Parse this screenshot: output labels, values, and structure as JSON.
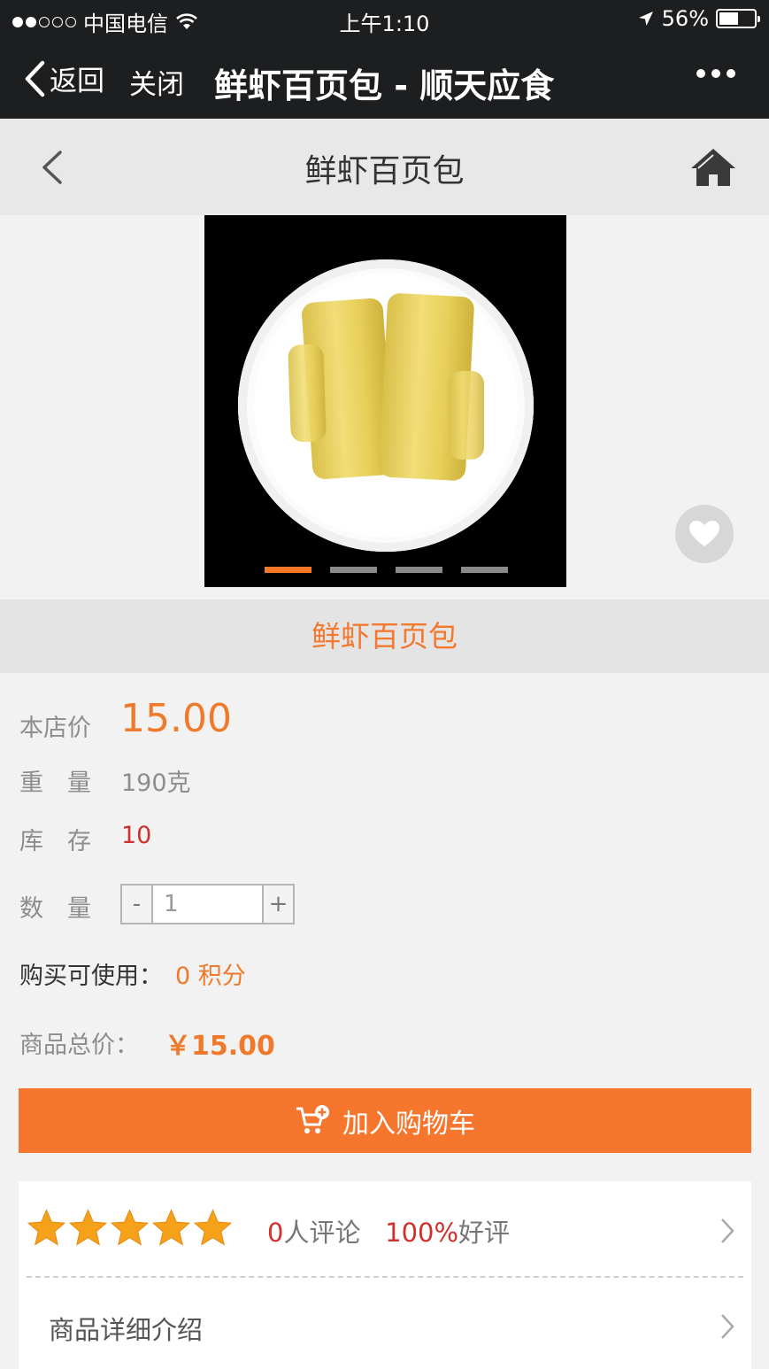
{
  "status_bar": {
    "carrier": "中国电信",
    "time": "上午1:10",
    "battery": "56%",
    "battery_level": 0.56
  },
  "wechat_nav": {
    "back_label": "返回",
    "close_label": "关闭",
    "title": "鲜虾百页包 - 顺天应食"
  },
  "page_header": {
    "title": "鲜虾百页包"
  },
  "gallery": {
    "slide_count": 4,
    "active_index": 0
  },
  "product": {
    "name": "鲜虾百页包",
    "price_label": "本店价",
    "price": "15.00",
    "weight_label": "重　量",
    "weight": "190克",
    "stock_label": "库　存",
    "stock": "10",
    "quantity_label": "数　量",
    "quantity": "1",
    "minus": "-",
    "plus": "+",
    "points_label": "购买可使用：",
    "points_value": "0 积分",
    "total_label": "商品总价：",
    "total_value": "￥15.00"
  },
  "cart": {
    "add_label": "加入购物车"
  },
  "reviews": {
    "rating_stars": 5,
    "count": "0",
    "count_suffix": "人评论",
    "positive_rate": "100%",
    "positive_suffix": "好评"
  },
  "details": {
    "label": "商品详细介绍"
  },
  "colors": {
    "accent": "#f5762c",
    "price": "#f07a2b",
    "stock": "#d0312d",
    "nav_bg": "#1d1e20"
  }
}
